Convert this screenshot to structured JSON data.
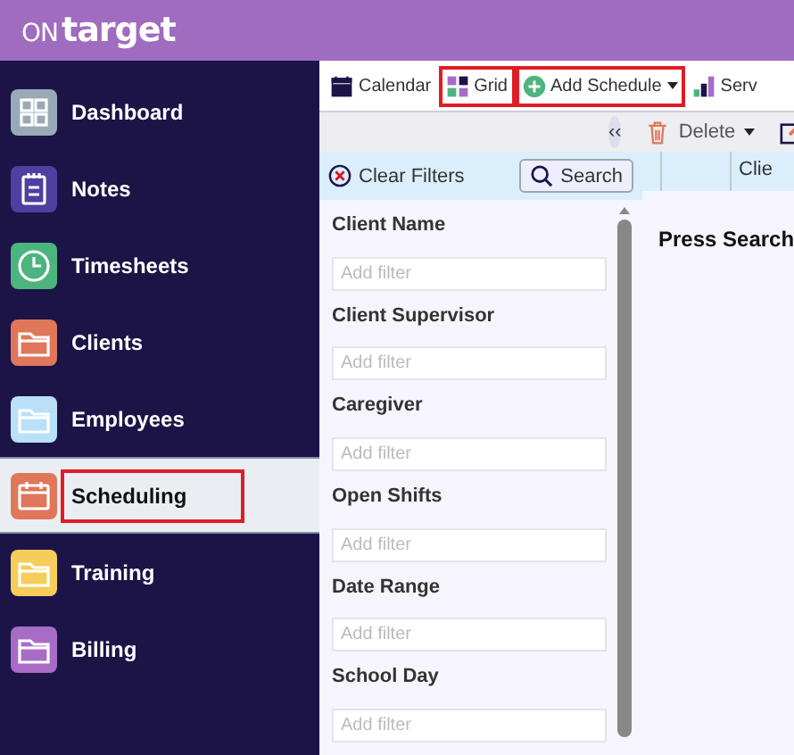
{
  "header": {
    "logo_prefix": "ON",
    "logo_suffix": "target"
  },
  "sidebar": {
    "items": [
      {
        "label": "Dashboard",
        "kind": "grid",
        "color": "#9aa9b8",
        "selected": false,
        "highlighted": false
      },
      {
        "label": "Notes",
        "kind": "notepad",
        "color": "#4f3fa0",
        "selected": false,
        "highlighted": false
      },
      {
        "label": "Timesheets",
        "kind": "clock",
        "color": "#4cb57e",
        "selected": false,
        "highlighted": false
      },
      {
        "label": "Clients",
        "kind": "folder",
        "color": "#e0775a",
        "selected": false,
        "highlighted": false
      },
      {
        "label": "Employees",
        "kind": "folder",
        "color": "#b9e0f7",
        "selected": false,
        "highlighted": false
      },
      {
        "label": "Scheduling",
        "kind": "calendar",
        "color": "#e0775a",
        "selected": true,
        "highlighted": true
      },
      {
        "label": "Training",
        "kind": "folder",
        "color": "#f5cd5a",
        "selected": false,
        "highlighted": false
      },
      {
        "label": "Billing",
        "kind": "folder",
        "color": "#a66cc6",
        "selected": false,
        "highlighted": false
      }
    ]
  },
  "toolbar": {
    "items": [
      {
        "label": "Calendar",
        "kind": "calendar",
        "dropdown": false,
        "highlighted": false
      },
      {
        "label": "Grid",
        "kind": "grid",
        "dropdown": false,
        "highlighted": true
      },
      {
        "label": "Add Schedule",
        "kind": "add",
        "dropdown": true,
        "highlighted": true
      },
      {
        "label": "Serv",
        "kind": "chart",
        "dropdown": false,
        "highlighted": false
      }
    ]
  },
  "actions": {
    "collapse": "‹‹",
    "delete": "Delete"
  },
  "filters": {
    "clear": "Clear Filters",
    "search": "Search",
    "fields": [
      {
        "label": "Client Name",
        "placeholder": "Add filter"
      },
      {
        "label": "Client Supervisor",
        "placeholder": "Add filter"
      },
      {
        "label": "Caregiver",
        "placeholder": "Add filter"
      },
      {
        "label": "Open Shifts",
        "placeholder": "Add filter"
      },
      {
        "label": "Date Range",
        "placeholder": "Add filter"
      },
      {
        "label": "School Day",
        "placeholder": "Add filter"
      }
    ]
  },
  "grid": {
    "column_3": "Clie",
    "message": "Press Search"
  }
}
